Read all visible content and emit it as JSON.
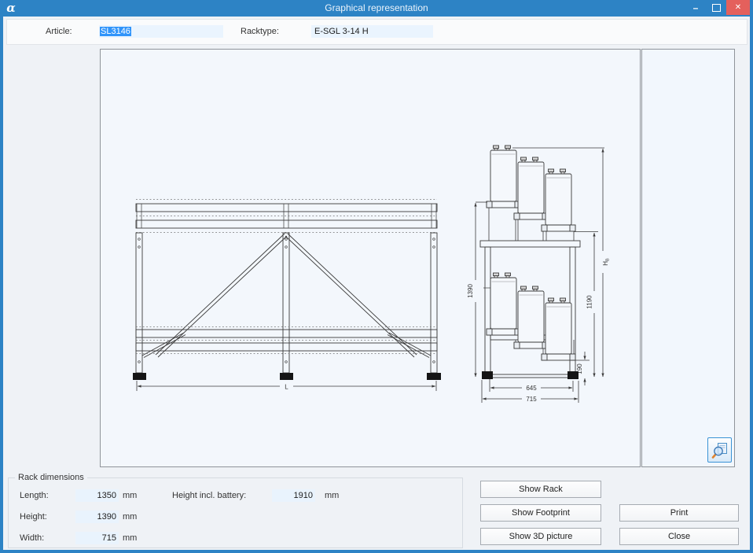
{
  "window": {
    "title": "Graphical representation",
    "logo_glyph": "α",
    "minimize_glyph": "–",
    "close_glyph": "✕"
  },
  "header": {
    "article_label": "Article:",
    "article_value": "SL3146",
    "racktype_label": "Racktype:",
    "racktype_value": "E-SGL 3-14 H"
  },
  "drawing": {
    "front_view": {
      "length_label": "L"
    },
    "side_view": {
      "dim_height_total": "1390",
      "dim_height_upper": "1190",
      "dim_height_lower": "190",
      "dim_width_inner": "645",
      "dim_width_outer": "715",
      "h_label": "H",
      "h_sub": "B"
    }
  },
  "rack_dimensions": {
    "group_label": "Rack dimensions",
    "rows": [
      {
        "label": "Length:",
        "value": "1350",
        "unit": "mm"
      },
      {
        "label": "Height:",
        "value": "1390",
        "unit": "mm"
      },
      {
        "label": "Width:",
        "value": "715",
        "unit": "mm"
      }
    ],
    "battery_row": {
      "label": "Height incl. battery:",
      "value": "1910",
      "unit": "mm"
    }
  },
  "buttons": {
    "show_rack": "Show Rack",
    "show_footprint": "Show Footprint",
    "show_3d": "Show 3D picture",
    "print": "Print",
    "close": "Close"
  },
  "icons": {
    "zoom_preview": "magnifier-over-page"
  },
  "colors": {
    "titlebar_blue": "#2d83c5",
    "close_red": "#e4605c",
    "selection_blue": "#3094fa",
    "field_bg": "#eaf4fe",
    "canvas_bg": "#f3f7fc"
  }
}
